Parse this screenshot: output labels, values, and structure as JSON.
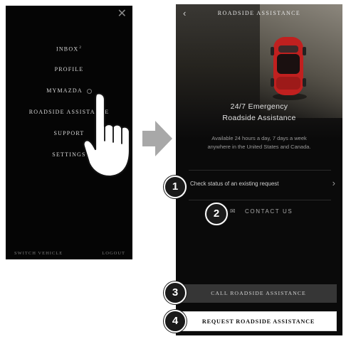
{
  "menu": {
    "close_icon": "close-icon",
    "items": [
      {
        "label": "INBOX",
        "superscript": "2"
      },
      {
        "label": "PROFILE"
      },
      {
        "label": "MYMAZDA"
      },
      {
        "label": "ROADSIDE ASSISTANCE"
      },
      {
        "label": "SUPPORT"
      },
      {
        "label": "SETTINGS"
      }
    ],
    "switch_vehicle": "SWITCH VEHICLE",
    "logout": "LOGOUT"
  },
  "assist": {
    "back_icon": "chevron-left-icon",
    "title": "ROADSIDE ASSISTANCE",
    "headline_line1": "24/7 Emergency",
    "headline_line2": "Roadside Assistance",
    "sub_line1": "Available 24 hours a day, 7 days a week",
    "sub_line2": "anywhere in the United States and Canada.",
    "status_label": "Check status of an existing request",
    "contact_label": "CONTACT US",
    "call_button": "CALL ROADSIDE ASSISTANCE",
    "request_button": "REQUEST ROADSIDE ASSISTANCE"
  },
  "callouts": [
    "1",
    "2",
    "3",
    "4"
  ],
  "colors": {
    "background": "#0a0a0a",
    "car_red": "#c0201f",
    "request_button_bg": "#ffffff",
    "call_button_bg": "#363636",
    "arrow": "#a8a8a8"
  }
}
